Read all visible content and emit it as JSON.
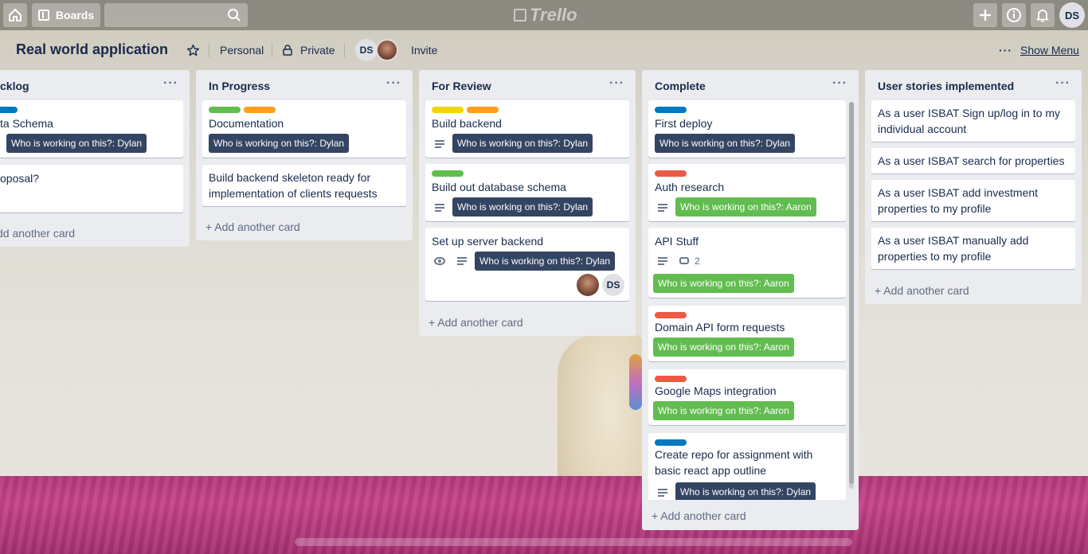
{
  "header": {
    "boards_label": "Boards",
    "logo_text": "Trello",
    "user_initials": "DS"
  },
  "board": {
    "title": "Real world application",
    "team": "Personal",
    "visibility": "Private",
    "member_initials": "DS",
    "invite_label": "Invite",
    "show_menu_label": "Show Menu"
  },
  "colors": {
    "dark_badge": "#344563",
    "green_badge": "#61bd4f",
    "label_blue": "#0079bf",
    "label_green": "#61bd4f",
    "label_orange": "#ff9f1a",
    "label_yellow": "#f2d600",
    "label_red": "#eb5a46"
  },
  "lists": {
    "backlog": {
      "title": "cklog",
      "cards": [
        {
          "title": "ta Schema",
          "badge": "Who is working on this?: Dylan"
        },
        {
          "title": "oposal?"
        }
      ],
      "add_label": "dd another card"
    },
    "in_progress": {
      "title": "In Progress",
      "cards": [
        {
          "title": "Documentation",
          "badge": "Who is working on this?: Dylan"
        },
        {
          "title": "Build backend skeleton ready for implementation of clients requests"
        }
      ],
      "add_label": "+ Add another card"
    },
    "for_review": {
      "title": "For Review",
      "cards": [
        {
          "title": "Build backend",
          "badge": "Who is working on this?: Dylan"
        },
        {
          "title": "Build out database schema",
          "badge": "Who is working on this?: Dylan"
        },
        {
          "title": "Set up server backend",
          "badge": "Who is working on this?: Dylan",
          "member": "DS"
        }
      ],
      "add_label": "+ Add another card"
    },
    "complete": {
      "title": "Complete",
      "cards": [
        {
          "title": "First deploy",
          "badge": "Who is working on this?: Dylan"
        },
        {
          "title": "Auth research",
          "badge": "Who is working on this?: Aaron"
        },
        {
          "title": "API Stuff",
          "comments": "2",
          "badge": "Who is working on this?: Aaron"
        },
        {
          "title": "Domain API form requests",
          "badge": "Who is working on this?: Aaron"
        },
        {
          "title": "Google Maps integration",
          "badge": "Who is working on this?: Aaron"
        },
        {
          "title": "Create repo for assignment with basic react app outline",
          "badge": "Who is working on this?: Dylan"
        }
      ],
      "add_label": "+ Add another card"
    },
    "user_stories": {
      "title": "User stories implemented",
      "cards": [
        {
          "title": "As a user ISBAT Sign up/log in to my individual account"
        },
        {
          "title": "As a user ISBAT search for properties"
        },
        {
          "title": "As a user ISBAT add investment properties to my profile"
        },
        {
          "title": "As a user ISBAT manually add properties to my profile"
        }
      ],
      "add_label": "+ Add another card"
    }
  }
}
